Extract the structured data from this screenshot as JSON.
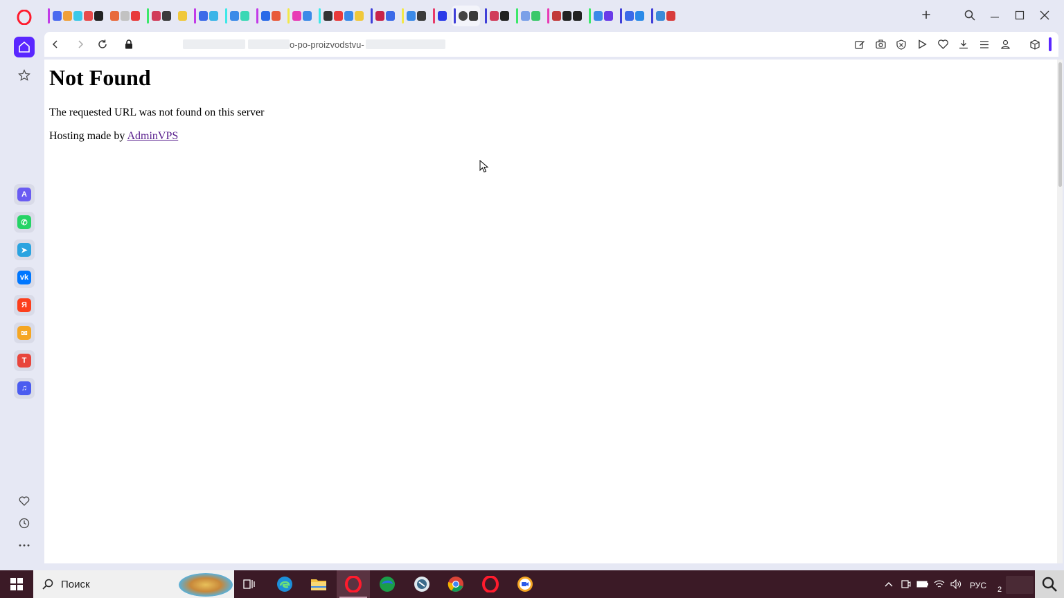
{
  "browser": {
    "name": "Opera",
    "accent": "#5a27ff",
    "url_visible_fragment": "o-po-proizvodstvu-",
    "window_controls": [
      "minimize",
      "maximize",
      "close"
    ],
    "tab_group_colors": [
      "#c23be8",
      "#f3e84a",
      "#3be86a",
      "#c23be8",
      "#3ee8e8",
      "#c23be8",
      "#f3e84a",
      "#3ee8e8",
      "#3f3fd8",
      "#f3e84a",
      "#e83b6a",
      "#3f3fd8",
      "#3f3fd8",
      "#3be86a",
      "#e83bb5",
      "#3be86a",
      "#3f3fd8",
      "#3f3fd8"
    ]
  },
  "page": {
    "heading": "Not Found",
    "message": "The requested URL was not found on this server",
    "hosting_prefix": "Hosting made by ",
    "hosting_link": "AdminVPS"
  },
  "sidebar": {
    "apps": [
      {
        "icon": "aria-icon",
        "color": "#6a5cf2",
        "glyph": "A"
      },
      {
        "icon": "whatsapp-icon",
        "color": "#25d366",
        "glyph": "✆"
      },
      {
        "icon": "telegram-icon",
        "color": "#2aa3e0",
        "glyph": "➤"
      },
      {
        "icon": "vk-icon",
        "color": "#0077ff",
        "glyph": "vk"
      },
      {
        "icon": "yandex-icon",
        "color": "#fc3f1d",
        "glyph": "Я"
      },
      {
        "icon": "mail-icon",
        "color": "#f5a623",
        "glyph": "✉"
      },
      {
        "icon": "translate-icon",
        "color": "#e8453c",
        "glyph": "T"
      },
      {
        "icon": "music-icon",
        "color": "#4b5cf0",
        "glyph": "♫"
      }
    ]
  },
  "taskbar": {
    "search_placeholder": "Поиск",
    "language": "РУС",
    "clock_fragment": "2"
  }
}
